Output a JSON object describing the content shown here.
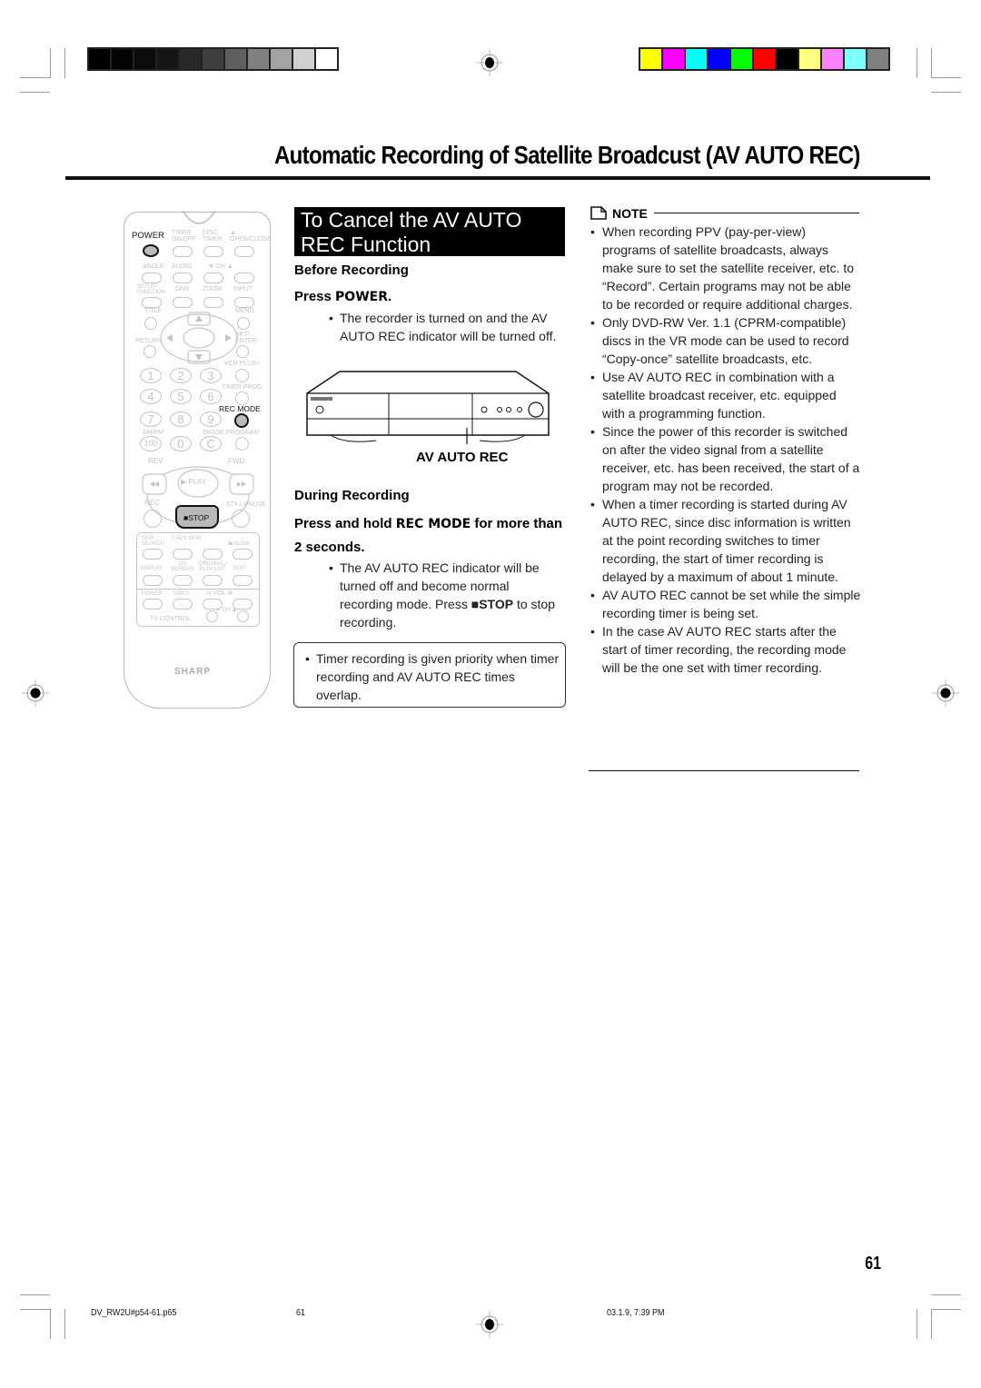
{
  "print_marks": {
    "gray_swatches": [
      "#000000",
      "#050505",
      "#0b0b0b",
      "#161616",
      "#282828",
      "#3f3f3f",
      "#5f5f5f",
      "#808080",
      "#a3a3a3",
      "#d0d0d0",
      "#ffffff"
    ],
    "color_swatches": [
      "#ffff00",
      "#ff00ff",
      "#00ffff",
      "#0000ff",
      "#00ff00",
      "#ff0000",
      "#000000",
      "#ffff80",
      "#ff80ff",
      "#80ffff",
      "#808080"
    ]
  },
  "header": {
    "title": "Automatic Recording of Satellite Broadcust (AV AUTO REC)"
  },
  "remote": {
    "brand": "SHARP",
    "labels": {
      "power": "POWER",
      "timer_onoff": "TIMER ON/OFF",
      "disc_timer": "DISC TIMER",
      "open_close": "▲ OPEN/CLOSE",
      "angle": "ANGLE",
      "audio": "AUDIO",
      "ch": "▼ CH ▲",
      "setup": "SETUP/ FUNCTION",
      "dnr": "DNR",
      "zoom": "ZOOM",
      "input": "INPUT",
      "title": "TITLE",
      "menu": "MENU",
      "return": "RETURN",
      "set_enter": "SET/ ENTER",
      "vcr_plus": "VCR PLUS+",
      "timer_prog": "TIMER PROG.",
      "rec_mode": "REC MODE",
      "am_pm": "AM/PM",
      "erase": "ERASE",
      "program": "PROGRAM",
      "rev": "REV",
      "fwd": "FWD",
      "play": "▶ PLAY",
      "rec": "REC",
      "still_pause": "STILL/PAUSE",
      "stop": "■STOP",
      "skip_search": "SKIP SEARCH",
      "fadv_skip": "F.ADV SKIP",
      "slow": "I▶SLOW",
      "display": "DISPLAY",
      "on_screen": "ON SCREEN",
      "original_playlist": "ORIGINAL/ PLAY LIST",
      "edit": "EDIT",
      "tv_power": "POWER",
      "tv_input": "INPUT",
      "vol": "⊖ VOL ⊕",
      "tv_ch": "▼ CH ▲",
      "tv_control": "TV CONTROL"
    },
    "numbers": [
      "1",
      "2",
      "3",
      "4",
      "5",
      "6",
      "7",
      "8",
      "9",
      "100",
      "0",
      "C"
    ]
  },
  "section": {
    "heading": "To Cancel the AV AUTO REC Function",
    "before": {
      "subheading": "Before Recording",
      "step_prefix": "Press ",
      "step_key": "POWER",
      "step_suffix": ".",
      "bullet": "The recorder is turned on and the AV AUTO REC indicator will be turned off."
    },
    "figure_label": "AV AUTO REC",
    "during": {
      "subheading": "During Recording",
      "step_prefix": "Press and hold ",
      "step_key": "REC MODE",
      "step_suffix": " for more than 2 seconds.",
      "bullet_a": "The AV AUTO REC indicator will be turned off and become normal recording mode. Press ",
      "bullet_key": "■STOP",
      "bullet_b": " to stop recording."
    },
    "callout": "Timer recording is given priority when timer recording and AV AUTO REC times overlap."
  },
  "note": {
    "label": "NOTE",
    "items": [
      "When recording PPV (pay-per-view) programs of satellite broadcasts, always make sure to set the satellite receiver, etc. to “Record”. Certain programs may not be able to be recorded or require additional charges.",
      "Only DVD-RW Ver. 1.1 (CPRM-compatible) discs in the VR mode can be used to record “Copy-once” satellite broadcasts, etc.",
      "Use AV AUTO REC in combination with a satellite broadcast receiver, etc. equipped with a programming function.",
      "Since the power of this recorder is switched on after the video signal from a satellite receiver, etc. has been received, the start of a program may not be recorded.",
      "When a timer recording is started during AV AUTO REC, since disc information is written at the point recording switches to timer recording, the start of timer recording is delayed by a maximum of about 1 minute.",
      "AV AUTO REC cannot be set while the simple recording timer is being set.",
      "In the case AV AUTO REC starts after the start of timer recording, the recording mode will be the one set with timer recording."
    ]
  },
  "footer": {
    "page_number": "61",
    "file_name": "DV_RW2U#p54-61.p65",
    "slug_page": "61",
    "timestamp": "03.1.9, 7:39 PM"
  }
}
